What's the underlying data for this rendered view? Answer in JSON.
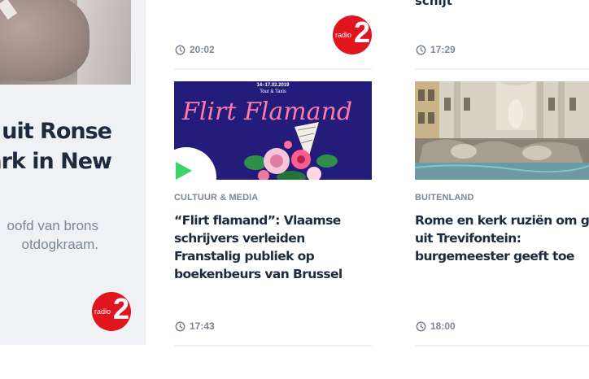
{
  "feature": {
    "title_lines": [
      "uit Ronse",
      "ark in New"
    ],
    "desc_lines": [
      "oofd van brons",
      "otdogkraam."
    ],
    "logo_text": "radio",
    "logo_digit": "2"
  },
  "top_row": {
    "partial_headline": "schijt",
    "logo_text": "radio",
    "logo_digit": "2",
    "times": [
      "20:02",
      "17:29"
    ]
  },
  "articles": [
    {
      "category": "CULTUUR & MEDIA",
      "headline_lines": [
        "“Flirt flamand”: Vlaamse",
        "schrijvers verleiden",
        "Franstalig publiek op",
        "boekenbeurs van Brussel"
      ],
      "time": "17:43",
      "image": {
        "date": "14–17.02.2019",
        "subtitle": "Tour & Taxis",
        "title": "Flirt Flamand"
      }
    },
    {
      "category": "BUITENLAND",
      "headline_lines": [
        "Rome en kerk ruziën om ge",
        "uit Trevifontein:",
        "burgemeester geeft toe"
      ],
      "time": "18:00"
    }
  ],
  "colors": {
    "text_dark": "#1e2a3d",
    "text_muted": "#7c8695",
    "radio_red": "#e1151e",
    "play_green": "#3bd36b",
    "card_bg": "#eff1f4"
  }
}
